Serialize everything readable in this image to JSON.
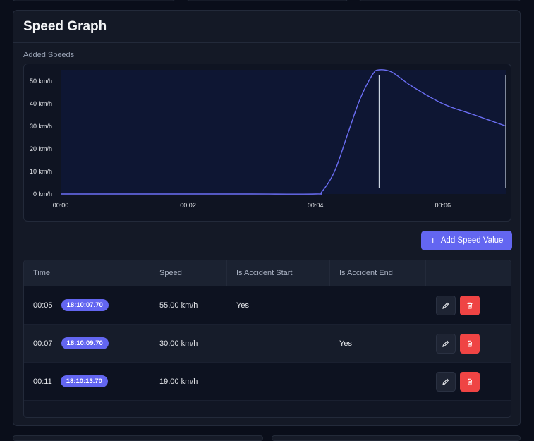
{
  "card": {
    "title": "Speed Graph",
    "section_label": "Added Speeds"
  },
  "chart_data": {
    "type": "line",
    "title": "",
    "xlabel": "",
    "ylabel": "",
    "x_ticks": [
      "00:00",
      "00:02",
      "00:04",
      "00:06"
    ],
    "y_ticks": [
      "0 km/h",
      "10 km/h",
      "20 km/h",
      "30 km/h",
      "40 km/h",
      "50 km/h"
    ],
    "xlim": [
      0,
      7
    ],
    "ylim": [
      0,
      55
    ],
    "series": [
      {
        "x": [
          0,
          1,
          2,
          3,
          4,
          4.1,
          4.3,
          4.5,
          4.7,
          4.9,
          5.0,
          5.2,
          5.5,
          6.0,
          6.5,
          7.0
        ],
        "y": [
          0,
          0,
          0,
          0,
          0,
          1,
          10,
          26,
          42,
          53,
          55,
          54,
          48,
          40,
          35,
          30
        ]
      }
    ],
    "markers": [
      5.0,
      7.0
    ],
    "line_color": "#6b6ef5",
    "marker_color": "#cbd5e1"
  },
  "add_button": {
    "label": "Add Speed Value"
  },
  "table": {
    "headers": [
      "Time",
      "Speed",
      "Is Accident Start",
      "Is Accident End"
    ],
    "rows": [
      {
        "time": "00:05",
        "stamp": "18:10:07.70",
        "speed": "55.00 km/h",
        "start": "Yes",
        "end": ""
      },
      {
        "time": "00:07",
        "stamp": "18:10:09.70",
        "speed": "30.00 km/h",
        "start": "",
        "end": "Yes"
      },
      {
        "time": "00:11",
        "stamp": "18:10:13.70",
        "speed": "19.00 km/h",
        "start": "",
        "end": ""
      }
    ]
  },
  "icons": {
    "edit": "pencil-icon",
    "delete": "trash-icon",
    "add": "plus-icon"
  },
  "colors": {
    "accent": "#6366f1",
    "danger": "#ef4444",
    "bg": "#0a0e1a",
    "card": "#141926"
  }
}
